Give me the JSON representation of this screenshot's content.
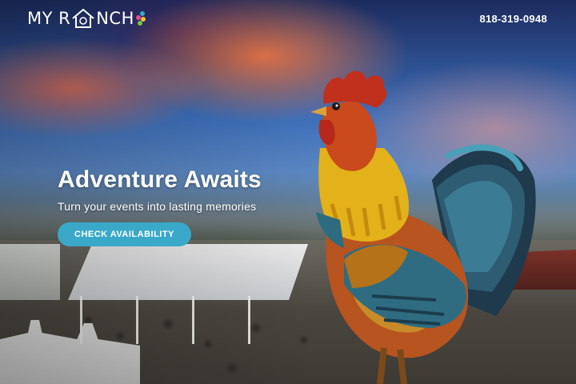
{
  "header": {
    "logo": {
      "prefix": "MY R",
      "suffix": "NCH"
    },
    "phone": "818-319-0948"
  },
  "hero": {
    "title": "Adventure Awaits",
    "subtitle": "Turn your events into lasting memories",
    "cta_label": "CHECK AVAILABILITY"
  },
  "colors": {
    "accent": "#3aa9c9",
    "text": "#ffffff"
  }
}
